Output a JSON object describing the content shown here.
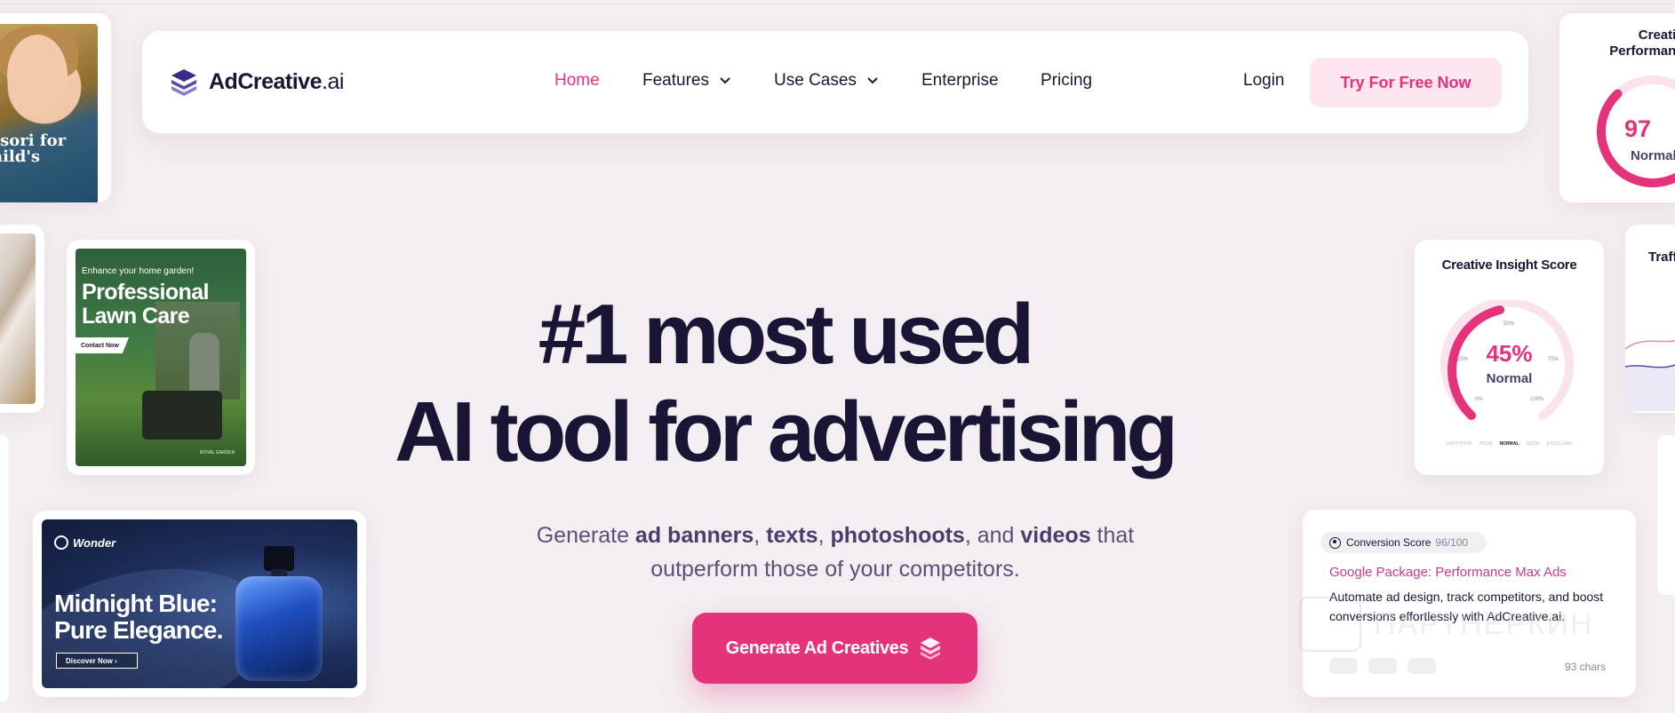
{
  "nav": {
    "brand": "AdCreative",
    "brand_suffix": ".ai",
    "items": [
      {
        "label": "Home",
        "active": true
      },
      {
        "label": "Features",
        "dropdown": true
      },
      {
        "label": "Use Cases",
        "dropdown": true
      },
      {
        "label": "Enterprise"
      },
      {
        "label": "Pricing"
      }
    ],
    "login": "Login",
    "cta": "Try For Free Now"
  },
  "hero": {
    "line1": "#1 most used",
    "line2": "AI tool for advertising",
    "sub_prefix": "Generate ",
    "sub_b1": "ad banners",
    "sub_sep1": ", ",
    "sub_b2": "texts",
    "sub_sep2": ", ",
    "sub_b3": "photoshoots",
    "sub_sep3": ", and ",
    "sub_b4": "videos",
    "sub_suffix": " that",
    "sub_line2": "outperform those of your competitors.",
    "cta": "Generate Ad Creatives"
  },
  "ads": {
    "kid_text": "ssori for\nhild's\n!",
    "lawn": {
      "small": "Enhance your home garden!",
      "title": "Professional Lawn Care",
      "button": "Contact Now",
      "brand": "ROYAL GARDEN"
    },
    "wonder": {
      "brand": "Wonder",
      "title_l1": "Midnight Blue:",
      "title_l2": "Pure Elegance.",
      "button": "Discover Now ›"
    }
  },
  "perf": {
    "title_l1": "Creative",
    "title_l2": "Performance",
    "value": "97",
    "label": "Normal"
  },
  "insight": {
    "title": "Creative Insight Score",
    "value": "45%",
    "label": "Normal",
    "ticks": [
      "0%",
      "25%",
      "50%",
      "75%",
      "100%"
    ],
    "scale": [
      "VERY POOR",
      "POOR",
      "NORMAL",
      "GOOD",
      "EXCELLENT"
    ]
  },
  "traffic": {
    "title": "Traff"
  },
  "conversion": {
    "pill_label": "Conversion Score",
    "pill_score": "96/100",
    "headline": "Google Package: Performance Max Ads",
    "body": "Automate ad design, track competitors, and boost conversions effortlessly with AdCreative.ai.",
    "chars": "93 chars"
  },
  "watermark": {
    "text": "ПАРТНЕРКИН"
  },
  "colors": {
    "accent": "#e5337b",
    "ink": "#1b1535",
    "background": "#f3eef1",
    "cta_soft": "#fde6ef"
  }
}
